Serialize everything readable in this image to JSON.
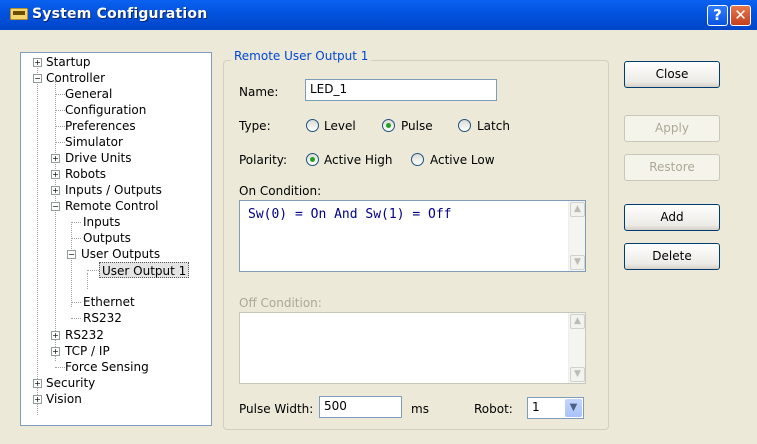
{
  "window": {
    "title": "System Configuration",
    "help_icon": "?",
    "close_icon": "✕"
  },
  "tree": {
    "startup": "Startup",
    "controller": "Controller",
    "general": "General",
    "configuration": "Configuration",
    "preferences": "Preferences",
    "simulator": "Simulator",
    "drive_units": "Drive Units",
    "robots": "Robots",
    "inputs_outputs": "Inputs / Outputs",
    "remote_control": "Remote Control",
    "inputs": "Inputs",
    "outputs": "Outputs",
    "user_outputs": "User Outputs",
    "user_output_1": "User Output 1",
    "ethernet": "Ethernet",
    "rs232_child": "RS232",
    "rs232": "RS232",
    "tcp_ip": "TCP / IP",
    "force_sensing": "Force Sensing",
    "security": "Security",
    "vision": "Vision"
  },
  "panel": {
    "group_title": "Remote User Output 1",
    "name_label": "Name:",
    "name_value": "LED_1",
    "type_label": "Type:",
    "type_options": [
      "Level",
      "Pulse",
      "Latch"
    ],
    "type_selected": "Pulse",
    "polarity_label": "Polarity:",
    "polarity_options": [
      "Active High",
      "Active Low"
    ],
    "polarity_selected": "Active High",
    "on_condition_label": "On Condition:",
    "on_condition_code": "Sw(0) = On And Sw(1) = Off",
    "off_condition_label": "Off Condition:",
    "off_condition_code": "",
    "pulse_width_label": "Pulse Width:",
    "pulse_width_value": "500",
    "pulse_unit": "ms",
    "robot_label": "Robot:",
    "robot_value": "1"
  },
  "buttons": {
    "close": "Close",
    "apply": "Apply",
    "restore": "Restore",
    "add": "Add",
    "delete": "Delete"
  },
  "colors": {
    "titlebar": "#0353e0",
    "group_title": "#0046d5",
    "code": "#00008b",
    "disabled_text": "#aca899"
  }
}
